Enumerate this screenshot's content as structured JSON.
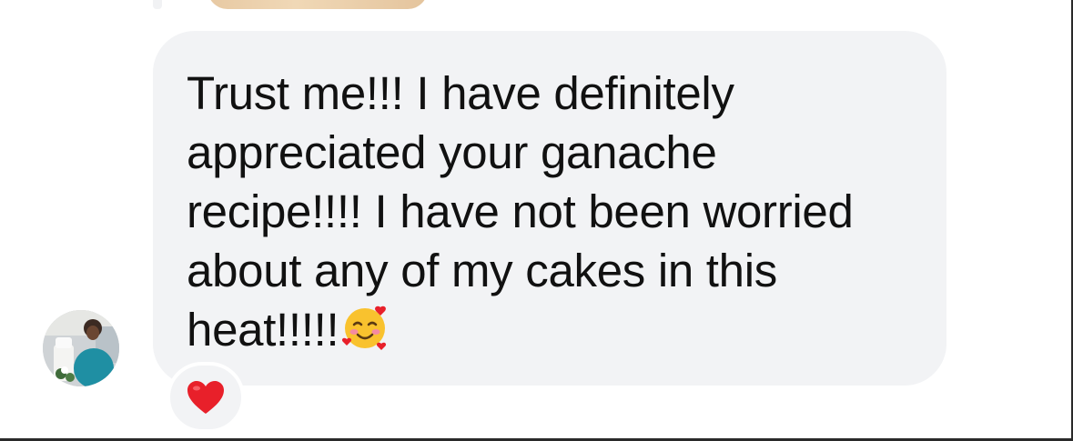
{
  "message": {
    "lines": [
      "Trust me!!! I have definitely",
      "appreciated your ganache",
      "recipe!!!! I have not been worried",
      "about any of my cakes in this",
      "heat!!!!!"
    ],
    "trailing_emoji": "smiling-face-with-hearts-icon"
  },
  "sender": {
    "avatar": "avatar-photo"
  },
  "reaction": {
    "icon": "red-heart-icon",
    "color": "#e8202a"
  },
  "colors": {
    "bubble_background": "#f2f3f5",
    "text": "#111111",
    "heart": "#e8202a",
    "emoji_face": "#f9c22e",
    "emoji_cheek": "#f58aa0"
  }
}
